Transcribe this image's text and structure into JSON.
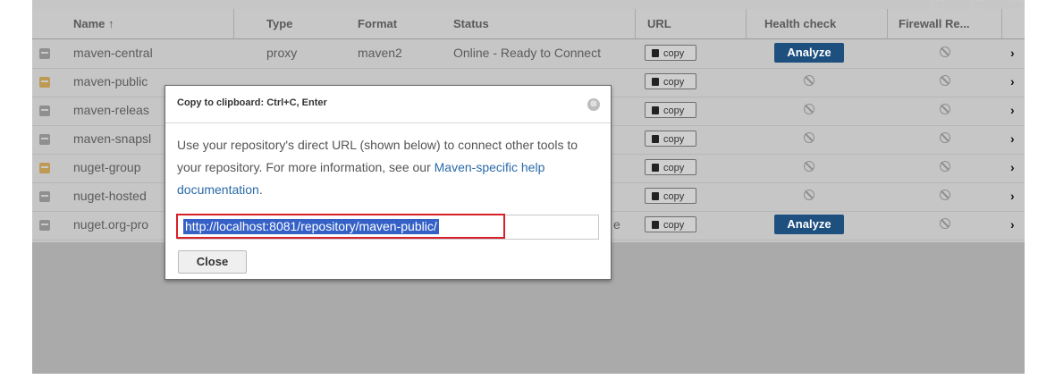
{
  "columns": {
    "name": "Name ↑",
    "type": "Type",
    "format": "Format",
    "status": "Status",
    "url": "URL",
    "health": "Health check",
    "firewall": "Firewall Re..."
  },
  "rows": [
    {
      "name": "maven-central",
      "type": "proxy",
      "format": "maven2",
      "status": "Online - Ready to Connect",
      "copy": "copy",
      "health": "Analyze",
      "icon": "proxy-repo-icon"
    },
    {
      "name": "maven-public",
      "type": "",
      "format": "",
      "status": "",
      "copy": "copy",
      "health": "",
      "icon": "group-repo-icon"
    },
    {
      "name": "maven-releas",
      "type": "",
      "format": "",
      "status": "",
      "copy": "copy",
      "health": "",
      "icon": "hosted-repo-icon"
    },
    {
      "name": "maven-snapsl",
      "type": "",
      "format": "",
      "status": "",
      "copy": "copy",
      "health": "",
      "icon": "hosted-repo-icon"
    },
    {
      "name": "nuget-group",
      "type": "",
      "format": "",
      "status": "",
      "copy": "copy",
      "health": "",
      "icon": "group-repo-icon"
    },
    {
      "name": "nuget-hosted",
      "type": "",
      "format": "",
      "status": "",
      "copy": "copy",
      "health": "",
      "icon": "hosted-repo-icon"
    },
    {
      "name": "nuget.org-pro",
      "type": "",
      "format": "",
      "status": "e",
      "copy": "copy",
      "health": "Analyze",
      "icon": "proxy-repo-icon"
    }
  ],
  "modal": {
    "title": "Copy to clipboard: Ctrl+C, Enter",
    "close_glyph": "⊗",
    "message_before": "Use your repository's direct URL (shown below) to connect other tools to your repository. For more information, see our ",
    "message_link": "Maven-specific help documentation",
    "message_after": ".",
    "url": "http://localhost:8081/repository/maven-public/",
    "close_label": "Close"
  },
  "colors": {
    "analyze_button": "#1d4f7f",
    "selection": "#3561c7",
    "highlight_box": "#d6202a"
  }
}
